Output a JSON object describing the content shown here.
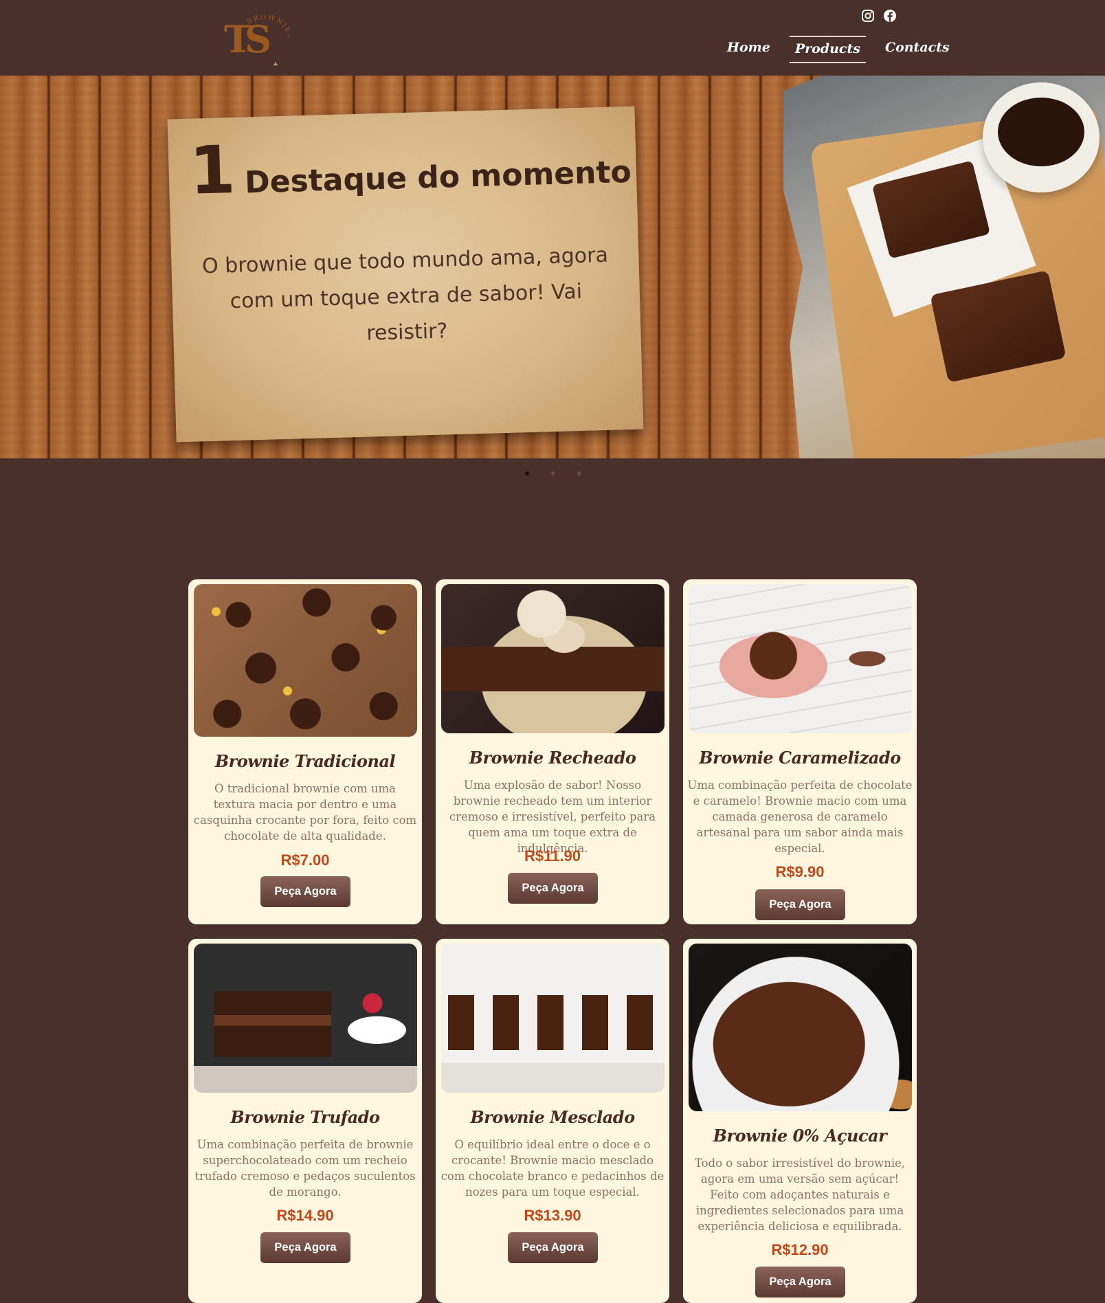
{
  "header": {
    "logo": {
      "monogram": "TS",
      "arc_text": "BROWNIES"
    },
    "social": [
      "instagram-icon",
      "facebook-icon"
    ],
    "nav": [
      {
        "label": "Home",
        "active": false
      },
      {
        "label": "Products",
        "active": true
      },
      {
        "label": "Contacts",
        "active": false
      }
    ]
  },
  "hero": {
    "number": "1",
    "title": "Destaque do momento",
    "subtitle": "O brownie que todo mundo ama, agora com um toque extra de sabor! Vai resistir?",
    "slides": 3,
    "active_slide": 1
  },
  "products": [
    {
      "name": "Brownie Tradicional",
      "description": "O tradicional brownie com uma textura macia por dentro e uma casquinha crocante por fora, feito com chocolate de alta qualidade.",
      "price": "R$7.00",
      "button": "Peça Agora"
    },
    {
      "name": "Brownie Recheado",
      "description": "Uma explosão de sabor! Nosso brownie recheado tem um interior cremoso e irresistível, perfeito para quem ama um toque extra de indulgência.",
      "price": "R$11.90",
      "button": "Peça Agora"
    },
    {
      "name": "Brownie Caramelizado",
      "description": "Uma combinação perfeita de chocolate e caramelo! Brownie macio com uma camada generosa de caramelo artesanal para um sabor ainda mais especial.",
      "price": "R$9.90",
      "button": "Peça Agora"
    },
    {
      "name": "Brownie Trufado",
      "description": "Uma combinação perfeita de brownie superchocolateado com um recheio trufado cremoso e pedaços suculentos de morango.",
      "price": "R$14.90",
      "button": "Peça Agora"
    },
    {
      "name": "Brownie Mesclado",
      "description": "O equilíbrio ideal entre o doce e o crocante! Brownie macio mesclado com chocolate branco e pedacinhos de nozes para um toque especial.",
      "price": "R$13.90",
      "button": "Peça Agora"
    },
    {
      "name": "Brownie 0% Açucar",
      "description": "Todo o sabor irresistível do brownie, agora em uma versão sem açúcar! Feito com adoçantes naturais e ingredientes selecionados para uma experiência deliciosa e equilibrada.",
      "price": "R$12.90",
      "button": "Peça Agora"
    }
  ],
  "colors": {
    "background": "#4a302b",
    "card": "#fff6e0",
    "price": "#c2491c",
    "button": "#6e4a40",
    "title": "#4a2a20"
  }
}
